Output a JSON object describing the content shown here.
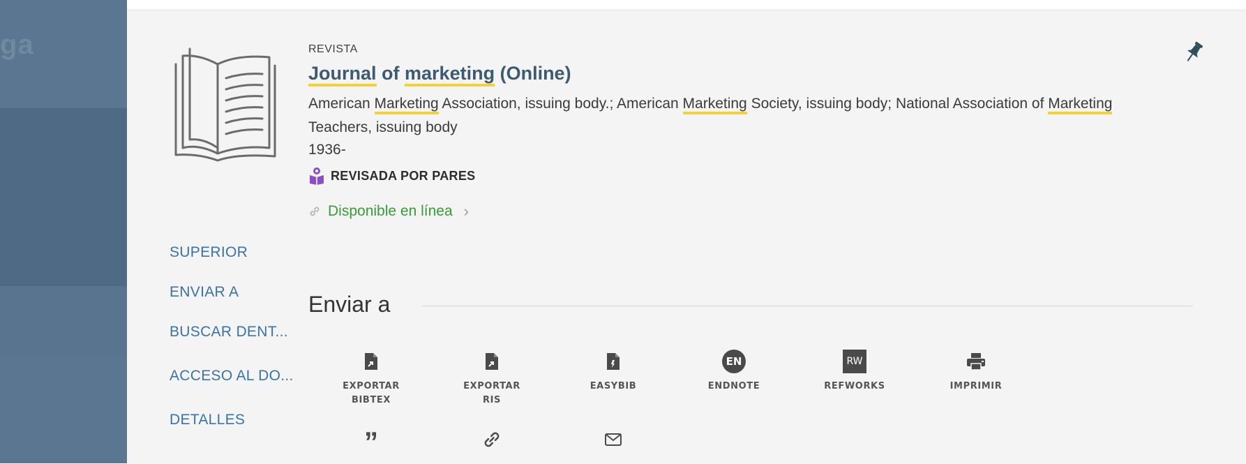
{
  "backdrop": {
    "ghost_text": "ga"
  },
  "record": {
    "type": "REVISTA",
    "title_parts": [
      "Journal",
      " of ",
      "marketing",
      " (Online)"
    ],
    "authors_parts": [
      "American ",
      "Marketing",
      " Association, issuing body.; American ",
      "Marketing",
      " Society, issuing body; National Association of ",
      "Marketing",
      " Teachers, issuing body"
    ],
    "year": "1936-",
    "peer_reviewed": "REVISADA POR PARES",
    "availability": "Disponible en línea",
    "availability_chevron": "›"
  },
  "colors": {
    "title": "#3c5a70",
    "highlight": "#f4d23c",
    "available": "#3a9a3a",
    "nav_link": "#3b73a4",
    "peer_icon": "#8b4fc4"
  },
  "sidenav": {
    "items": [
      {
        "label": "SUPERIOR"
      },
      {
        "label": "ENVIAR A"
      },
      {
        "label": "BUSCAR DENT..."
      },
      {
        "label": "ACCESO AL DO..."
      },
      {
        "label": "DETALLES"
      }
    ]
  },
  "send_to": {
    "title": "Enviar a",
    "actions": [
      {
        "icon": "file-export-icon",
        "label": "EXPORTAR\nBIBTEX"
      },
      {
        "icon": "file-export-icon",
        "label": "EXPORTAR\nRIS"
      },
      {
        "icon": "easybib-file-icon",
        "label": "EASYBIB"
      },
      {
        "icon": "endnote-icon",
        "icon_text": "EN",
        "label": "ENDNOTE"
      },
      {
        "icon": "refworks-icon",
        "icon_text": "RW",
        "label": "REFWORKS"
      },
      {
        "icon": "printer-icon",
        "label": "IMPRIMIR"
      },
      {
        "icon": "quote-icon",
        "icon_text": "”",
        "label": ""
      },
      {
        "icon": "link-icon",
        "label": ""
      },
      {
        "icon": "email-icon",
        "label": ""
      }
    ]
  }
}
